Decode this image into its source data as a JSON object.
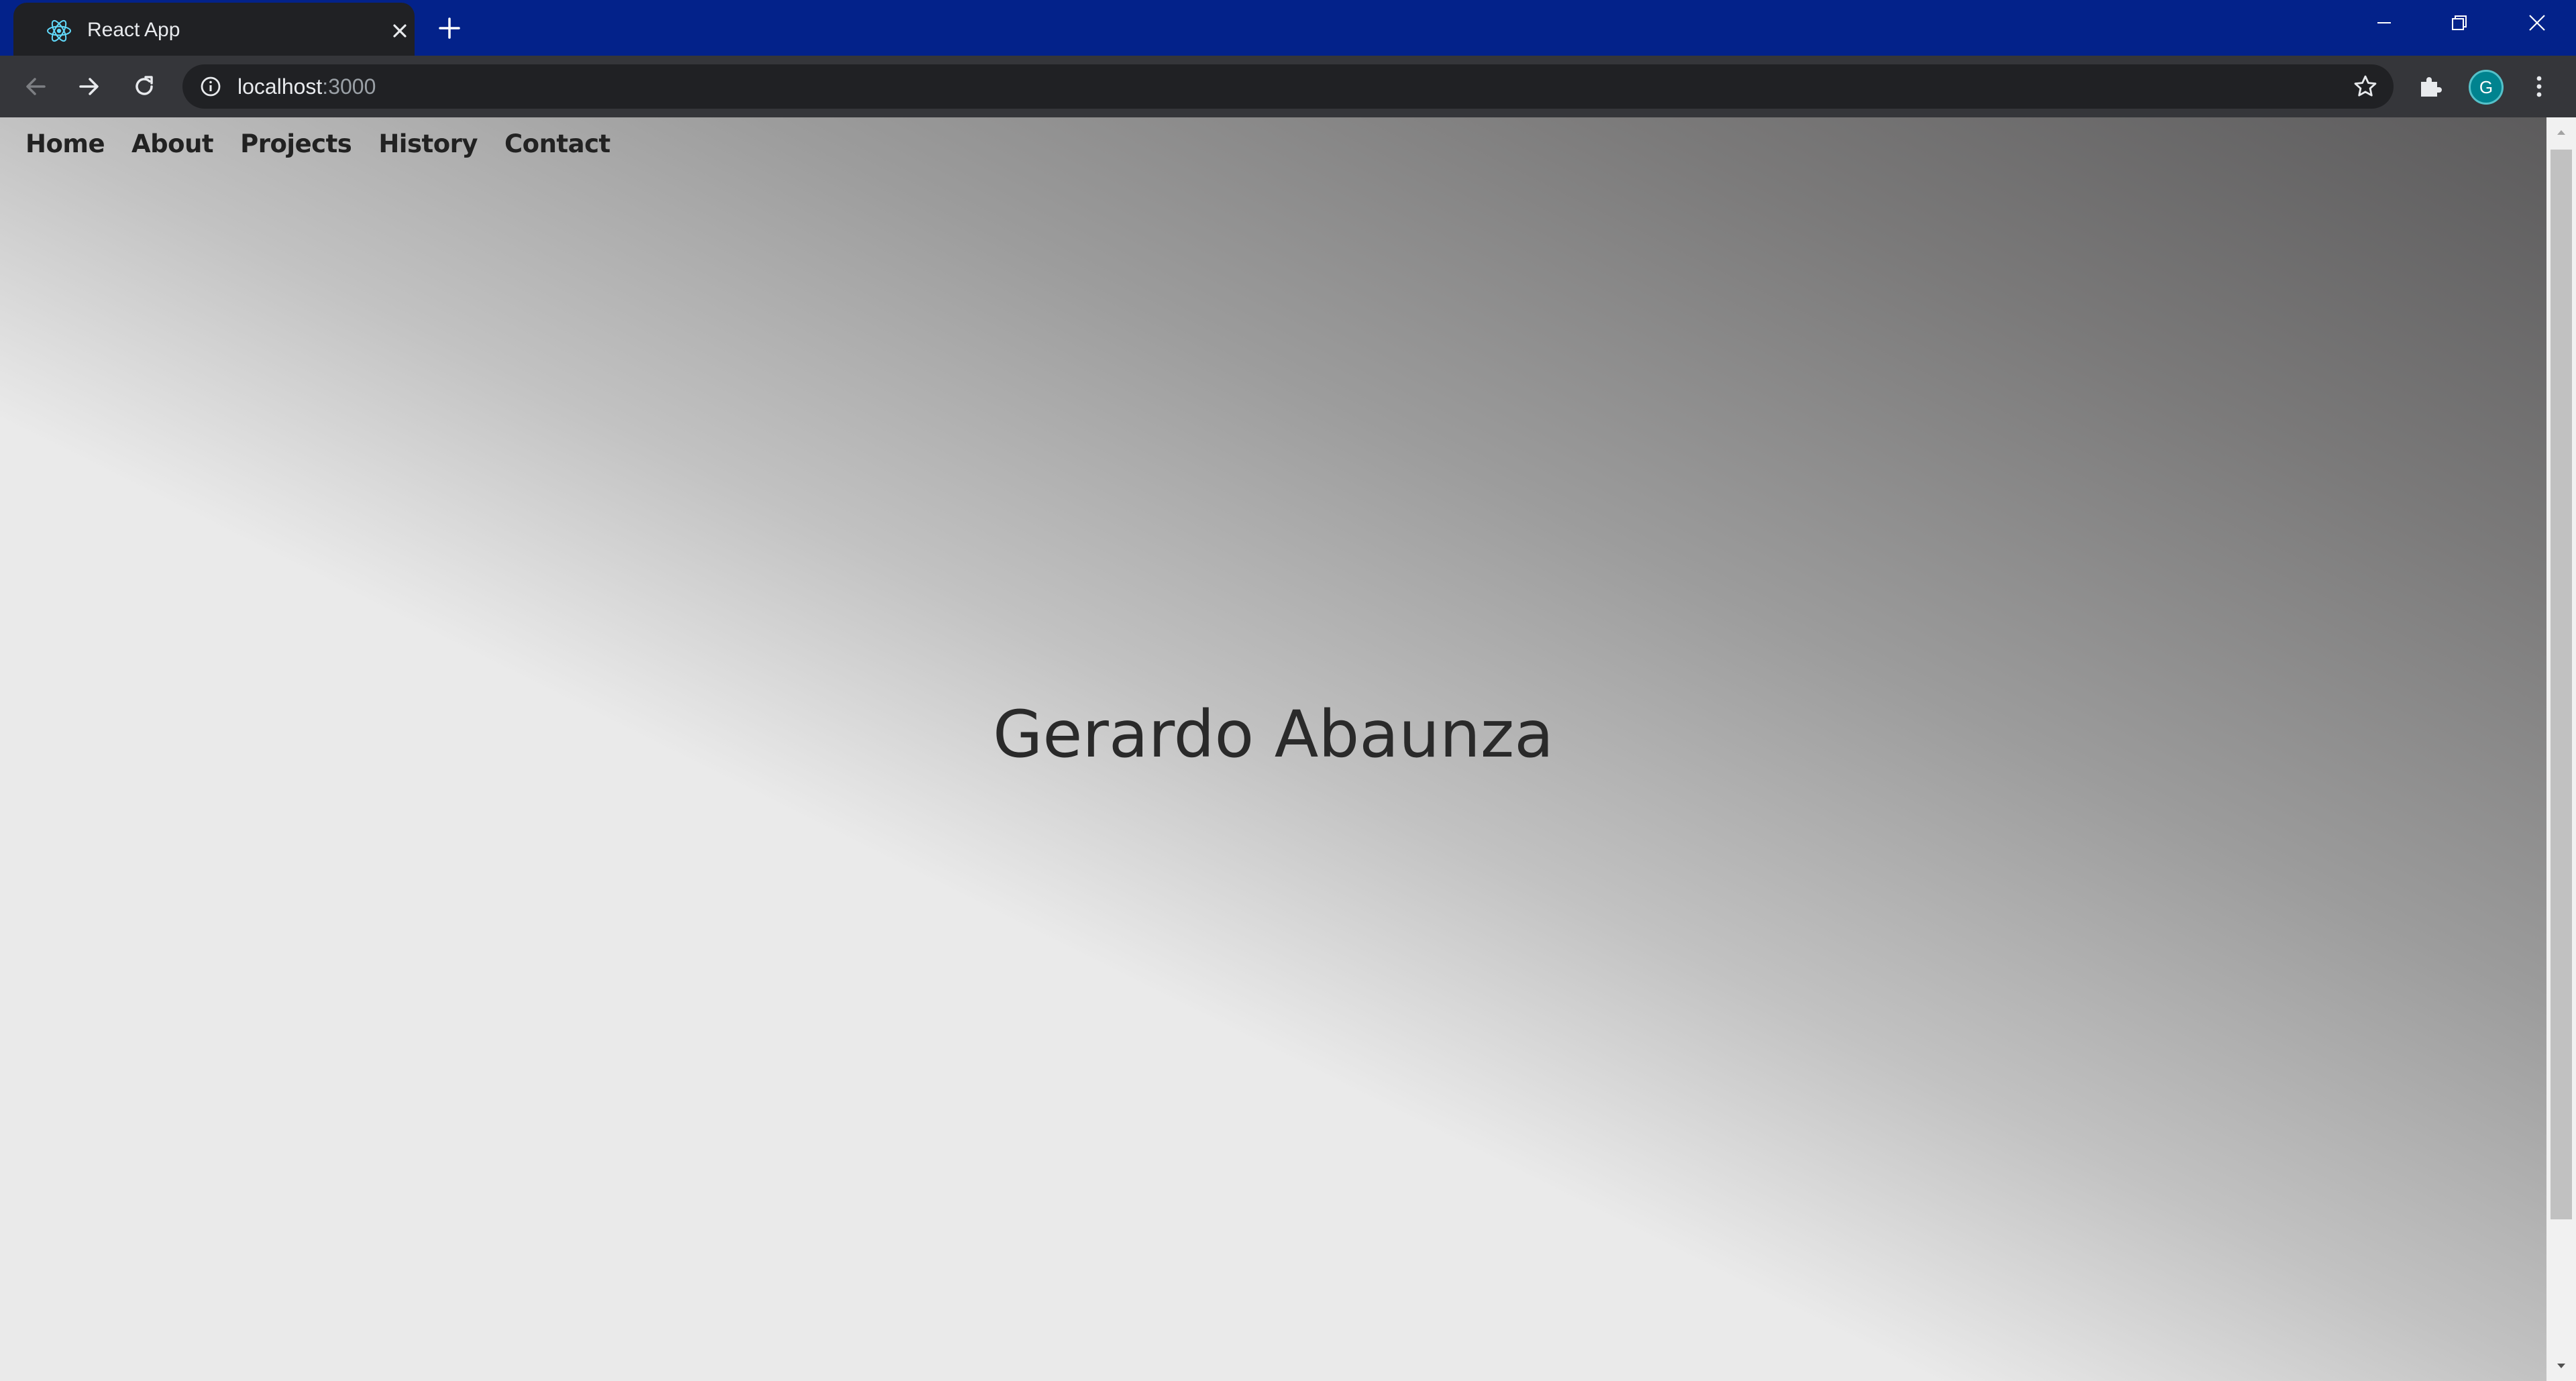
{
  "browser": {
    "tab": {
      "title": "React App",
      "favicon": "react-logo-icon"
    },
    "address_bar": {
      "host": "localhost",
      "port": ":3000"
    },
    "profile_initial": "G",
    "colors": {
      "titlebar": "#03228a",
      "toolbar": "#35363a",
      "omnibox": "#202124",
      "avatar": "#00838f"
    }
  },
  "page": {
    "nav": {
      "items": [
        {
          "label": "Home"
        },
        {
          "label": "About"
        },
        {
          "label": "Projects"
        },
        {
          "label": "History"
        },
        {
          "label": "Contact"
        }
      ]
    },
    "hero": {
      "name": "Gerardo Abaunza"
    },
    "background": {
      "gradient_from": "#eaeaea",
      "gradient_to": "#5c5b5c",
      "direction": "bottom-left to top-right"
    },
    "text_color": "#222222"
  }
}
